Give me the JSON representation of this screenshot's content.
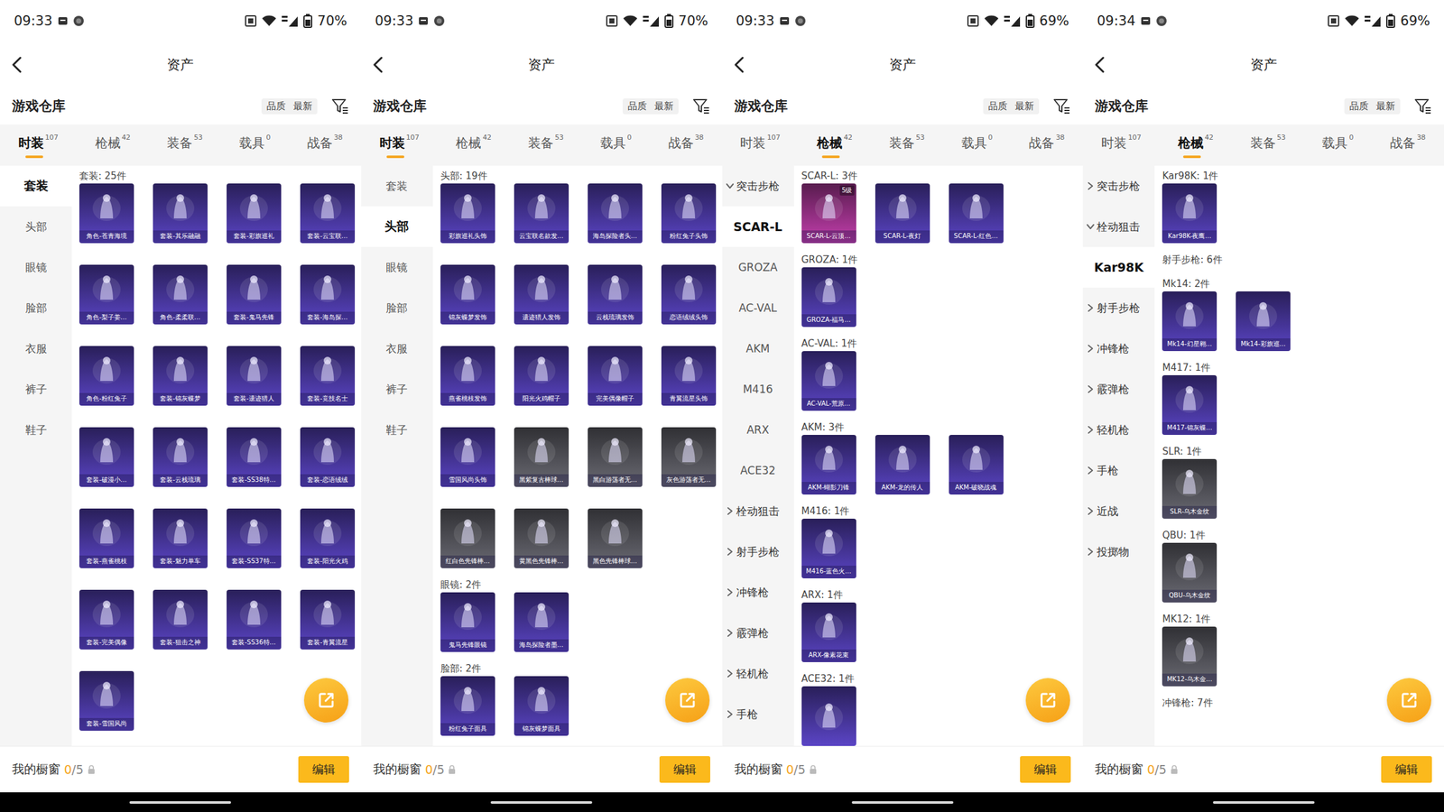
{
  "panels": [
    {
      "status_bar": {
        "time": "09:33",
        "battery": "70%"
      },
      "header": {
        "title": "资产"
      },
      "warehouse": {
        "title": "游戏仓库",
        "sort_options": [
          {
            "label": "品质"
          },
          {
            "label": "最新"
          }
        ]
      },
      "tabs": [
        {
          "label": "时装",
          "count": "107",
          "selected": true
        },
        {
          "label": "枪械",
          "count": "42",
          "selected": false
        },
        {
          "label": "装备",
          "count": "53",
          "selected": false
        },
        {
          "label": "载具",
          "count": "0",
          "selected": false
        },
        {
          "label": "战备",
          "count": "38",
          "selected": false
        }
      ],
      "sidebar": [
        {
          "label": "套装",
          "kind": "category",
          "selected": true
        },
        {
          "label": "头部",
          "kind": "category",
          "selected": false
        },
        {
          "label": "眼镜",
          "kind": "category",
          "selected": false
        },
        {
          "label": "脸部",
          "kind": "category",
          "selected": false
        },
        {
          "label": "衣服",
          "kind": "category",
          "selected": false
        },
        {
          "label": "裤子",
          "kind": "category",
          "selected": false
        },
        {
          "label": "鞋子",
          "kind": "category",
          "selected": false
        }
      ],
      "sections": [
        {
          "title": "套装: 25件",
          "items": [
            {
              "label": "角色-苍青海境",
              "color": "#5b45c6"
            },
            {
              "label": "套装-其乐融融",
              "color": "#5b45c6"
            },
            {
              "label": "套装-彩旗巡礼",
              "color": "#5b45c6"
            },
            {
              "label": "套装-云宝联…",
              "color": "#5b45c6"
            },
            {
              "label": "角色-梨子姜…",
              "color": "#5b45c6"
            },
            {
              "label": "角色-柔柔联…",
              "color": "#5b45c6"
            },
            {
              "label": "套装-鬼马先锋",
              "color": "#5b45c6"
            },
            {
              "label": "套装-海岛探…",
              "color": "#5b45c6"
            },
            {
              "label": "角色-粉红兔子",
              "color": "#5b45c6"
            },
            {
              "label": "套装-锦灰蝶梦",
              "color": "#5b45c6"
            },
            {
              "label": "套装-遗迹猎人",
              "color": "#5b45c6"
            },
            {
              "label": "套装-竞技名士",
              "color": "#5b45c6"
            },
            {
              "label": "套装-破漫小…",
              "color": "#5b45c6"
            },
            {
              "label": "套装-云栈琉璃",
              "color": "#5b45c6"
            },
            {
              "label": "套装-SS38特…",
              "color": "#5b45c6"
            },
            {
              "label": "套装-恋语绒绒",
              "color": "#5b45c6"
            },
            {
              "label": "套装-燕雀桃枝",
              "color": "#5b45c6"
            },
            {
              "label": "套装-魅力单车",
              "color": "#5b45c6"
            },
            {
              "label": "套装-SS37特…",
              "color": "#5b45c6"
            },
            {
              "label": "套装-阳光火鸡",
              "color": "#5b45c6"
            },
            {
              "label": "套装-完美偶像",
              "color": "#5b45c6"
            },
            {
              "label": "套装-狙击之神",
              "color": "#5b45c6"
            },
            {
              "label": "套装-SS36特…",
              "color": "#5b45c6"
            },
            {
              "label": "套装-青翼流星",
              "color": "#5b45c6"
            },
            {
              "label": "套装-雪国风尚",
              "color": "#5b45c6"
            }
          ]
        }
      ],
      "showcase": {
        "label": "我的橱窗",
        "count": "0",
        "total": "/5"
      },
      "edit_button": "编辑"
    },
    {
      "status_bar": {
        "time": "09:33",
        "battery": "70%"
      },
      "header": {
        "title": "资产"
      },
      "warehouse": {
        "title": "游戏仓库",
        "sort_options": [
          {
            "label": "品质"
          },
          {
            "label": "最新"
          }
        ]
      },
      "tabs": [
        {
          "label": "时装",
          "count": "107",
          "selected": true
        },
        {
          "label": "枪械",
          "count": "42",
          "selected": false
        },
        {
          "label": "装备",
          "count": "53",
          "selected": false
        },
        {
          "label": "载具",
          "count": "0",
          "selected": false
        },
        {
          "label": "战备",
          "count": "38",
          "selected": false
        }
      ],
      "sidebar": [
        {
          "label": "套装",
          "kind": "category",
          "selected": false
        },
        {
          "label": "头部",
          "kind": "category",
          "selected": true
        },
        {
          "label": "眼镜",
          "kind": "category",
          "selected": false
        },
        {
          "label": "脸部",
          "kind": "category",
          "selected": false
        },
        {
          "label": "衣服",
          "kind": "category",
          "selected": false
        },
        {
          "label": "裤子",
          "kind": "category",
          "selected": false
        },
        {
          "label": "鞋子",
          "kind": "category",
          "selected": false
        }
      ],
      "sections": [
        {
          "title": "头部: 19件",
          "items": [
            {
              "label": "彩旗巡礼头饰",
              "color": "#5b45c6"
            },
            {
              "label": "云宝联名款发…",
              "color": "#5b45c6"
            },
            {
              "label": "海岛探险者头…",
              "color": "#5b45c6"
            },
            {
              "label": "粉红兔子头饰",
              "color": "#5b45c6"
            },
            {
              "label": "锦灰蝶梦发饰",
              "color": "#5b45c6"
            },
            {
              "label": "遗迹猎人发饰",
              "color": "#5b45c6"
            },
            {
              "label": "云栈琉璃发饰",
              "color": "#5b45c6"
            },
            {
              "label": "恋语绒绒头饰",
              "color": "#5b45c6"
            },
            {
              "label": "燕雀桃枝发饰",
              "color": "#5b45c6"
            },
            {
              "label": "阳光火鸡帽子",
              "color": "#5b45c6"
            },
            {
              "label": "完美偶像帽子",
              "color": "#5b45c6"
            },
            {
              "label": "青翼流星头饰",
              "color": "#5b45c6"
            },
            {
              "label": "雪国风尚头饰",
              "color": "#5b45c6"
            },
            {
              "label": "黑紫复古棒球…",
              "color": "#6b6b74"
            },
            {
              "label": "黑白游荡者无…",
              "color": "#6b6b74"
            },
            {
              "label": "灰色游荡者无…",
              "color": "#6b6b74"
            },
            {
              "label": "红白色先锋棒…",
              "color": "#6b6b74"
            },
            {
              "label": "黄黑色先锋棒…",
              "color": "#6b6b74"
            },
            {
              "label": "黑色先锋棒球…",
              "color": "#6b6b74"
            }
          ]
        },
        {
          "title": "眼镜: 2件",
          "items": [
            {
              "label": "鬼马先锋眼镜",
              "color": "#5b45c6"
            },
            {
              "label": "海岛探险者墨…",
              "color": "#5b45c6"
            }
          ]
        },
        {
          "title": "脸部: 2件",
          "items": [
            {
              "label": "粉红兔子面具",
              "color": "#5b45c6"
            },
            {
              "label": "锦灰蝶梦面具",
              "color": "#5b45c6"
            }
          ]
        }
      ],
      "showcase": {
        "label": "我的橱窗",
        "count": "0",
        "total": "/5"
      },
      "edit_button": "编辑"
    },
    {
      "status_bar": {
        "time": "09:33",
        "battery": "69%"
      },
      "header": {
        "title": "资产"
      },
      "warehouse": {
        "title": "游戏仓库",
        "sort_options": [
          {
            "label": "品质"
          },
          {
            "label": "最新"
          }
        ]
      },
      "tabs": [
        {
          "label": "时装",
          "count": "107",
          "selected": false
        },
        {
          "label": "枪械",
          "count": "42",
          "selected": true
        },
        {
          "label": "装备",
          "count": "53",
          "selected": false
        },
        {
          "label": "载具",
          "count": "0",
          "selected": false
        },
        {
          "label": "战备",
          "count": "38",
          "selected": false
        }
      ],
      "sidebar": [
        {
          "label": "突击步枪",
          "kind": "group",
          "selected": false,
          "expanded": true
        },
        {
          "label": "SCAR-L",
          "kind": "sub",
          "selected": true
        },
        {
          "label": "GROZA",
          "kind": "sub",
          "selected": false
        },
        {
          "label": "AC-VAL",
          "kind": "sub",
          "selected": false
        },
        {
          "label": "AKM",
          "kind": "sub",
          "selected": false
        },
        {
          "label": "M416",
          "kind": "sub",
          "selected": false
        },
        {
          "label": "ARX",
          "kind": "sub",
          "selected": false
        },
        {
          "label": "ACE32",
          "kind": "sub",
          "selected": false
        },
        {
          "label": "栓动狙击",
          "kind": "group",
          "selected": false,
          "expanded": false
        },
        {
          "label": "射手步枪",
          "kind": "group",
          "selected": false,
          "expanded": false
        },
        {
          "label": "冲锋枪",
          "kind": "group",
          "selected": false,
          "expanded": false
        },
        {
          "label": "霰弹枪",
          "kind": "group",
          "selected": false,
          "expanded": false
        },
        {
          "label": "轻机枪",
          "kind": "group",
          "selected": false,
          "expanded": false
        },
        {
          "label": "手枪",
          "kind": "group",
          "selected": false,
          "expanded": false
        }
      ],
      "sections": [
        {
          "title": "SCAR-L: 3件",
          "items": [
            {
              "label": "SCAR-L-云顶…",
              "color": "#c43fae",
              "badge": "5级"
            },
            {
              "label": "SCAR-L-夜灯",
              "color": "#5b45c6"
            },
            {
              "label": "SCAR-L-红色…",
              "color": "#5b45c6"
            }
          ]
        },
        {
          "title": "GROZA: 1件",
          "items": [
            {
              "label": "GROZA-福马…",
              "color": "#5b45c6"
            }
          ]
        },
        {
          "title": "AC-VAL: 1件",
          "items": [
            {
              "label": "AC-VAL-荒原…",
              "color": "#5b45c6"
            }
          ]
        },
        {
          "title": "AKM: 3件",
          "items": [
            {
              "label": "AKM-蝴影刀锋",
              "color": "#5b45c6"
            },
            {
              "label": "AKM-龙的传人",
              "color": "#5b45c6"
            },
            {
              "label": "AKM-破晓战魂",
              "color": "#5b45c6"
            }
          ]
        },
        {
          "title": "M416: 1件",
          "items": [
            {
              "label": "M416-蓝色火…",
              "color": "#5b45c6"
            }
          ]
        },
        {
          "title": "ARX: 1件",
          "items": [
            {
              "label": "ARX-像素花束",
              "color": "#5b45c6"
            }
          ]
        },
        {
          "title": "ACE32: 1件",
          "items": [
            {
              "color": "#5b45c6"
            }
          ]
        }
      ],
      "showcase": {
        "label": "我的橱窗",
        "count": "0",
        "total": "/5"
      },
      "edit_button": "编辑"
    },
    {
      "status_bar": {
        "time": "09:34",
        "battery": "69%"
      },
      "header": {
        "title": "资产"
      },
      "warehouse": {
        "title": "游戏仓库",
        "sort_options": [
          {
            "label": "品质"
          },
          {
            "label": "最新"
          }
        ]
      },
      "tabs": [
        {
          "label": "时装",
          "count": "107",
          "selected": false
        },
        {
          "label": "枪械",
          "count": "42",
          "selected": true
        },
        {
          "label": "装备",
          "count": "53",
          "selected": false
        },
        {
          "label": "载具",
          "count": "0",
          "selected": false
        },
        {
          "label": "战备",
          "count": "38",
          "selected": false
        }
      ],
      "sidebar": [
        {
          "label": "突击步枪",
          "kind": "group",
          "selected": false,
          "expanded": false
        },
        {
          "label": "栓动狙击",
          "kind": "group",
          "selected": false,
          "expanded": true
        },
        {
          "label": "Kar98K",
          "kind": "sub",
          "selected": true
        },
        {
          "label": "射手步枪",
          "kind": "group",
          "selected": false,
          "expanded": false
        },
        {
          "label": "冲锋枪",
          "kind": "group",
          "selected": false,
          "expanded": false
        },
        {
          "label": "霰弹枪",
          "kind": "group",
          "selected": false,
          "expanded": false
        },
        {
          "label": "轻机枪",
          "kind": "group",
          "selected": false,
          "expanded": false
        },
        {
          "label": "手枪",
          "kind": "group",
          "selected": false,
          "expanded": false
        },
        {
          "label": "近战",
          "kind": "group",
          "selected": false,
          "expanded": false
        },
        {
          "label": "投掷物",
          "kind": "group",
          "selected": false,
          "expanded": false
        }
      ],
      "sections": [
        {
          "title": "Kar98K: 1件",
          "items": [
            {
              "label": "Kar98K-夜鹰…",
              "color": "#5b45c6"
            }
          ]
        },
        {
          "title": "射手步枪: 6件",
          "items": []
        },
        {
          "title": "Mk14: 2件",
          "items": [
            {
              "label": "Mk14-幻星翱…",
              "color": "#5b45c6"
            },
            {
              "label": "Mk14-彩旗巡…",
              "color": "#5b45c6"
            }
          ]
        },
        {
          "title": "M417: 1件",
          "items": [
            {
              "label": "M417-锦灰蝶…",
              "color": "#5b45c6"
            }
          ]
        },
        {
          "title": "SLR: 1件",
          "items": [
            {
              "label": "SLR-乌木金纹",
              "color": "#6b6b74"
            }
          ]
        },
        {
          "title": "QBU: 1件",
          "items": [
            {
              "label": "QBU-乌木金纹",
              "color": "#6b6b74"
            }
          ]
        },
        {
          "title": "MK12: 1件",
          "items": [
            {
              "label": "MK12-乌木金…",
              "color": "#6b6b74"
            }
          ]
        },
        {
          "title": "冲锋枪: 7件",
          "items": []
        }
      ],
      "showcase": {
        "label": "我的橱窗",
        "count": "0",
        "total": "/5"
      },
      "edit_button": "编辑"
    }
  ]
}
